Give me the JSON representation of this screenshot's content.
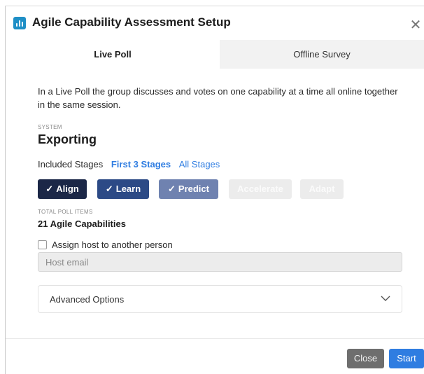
{
  "dialog": {
    "title": "Agile Capability Assessment Setup",
    "app_icon": "bar-chart-icon",
    "close_icon": "close-icon",
    "accent_color": "#1f8fc6"
  },
  "tabs": [
    {
      "label": "Live Poll",
      "active": true
    },
    {
      "label": "Offline Survey",
      "active": false
    }
  ],
  "intro": "In a Live Poll the group discusses and votes on one capability at a time all online together in the same session.",
  "system": {
    "label": "SYSTEM",
    "name": "Exporting"
  },
  "stages": {
    "label": "Included Stages",
    "options": [
      {
        "label": "First 3 Stages",
        "active": true
      },
      {
        "label": "All Stages",
        "active": false
      }
    ],
    "buttons": [
      {
        "label": "Align",
        "selected": true,
        "color": "#1b2747"
      },
      {
        "label": "Learn",
        "selected": true,
        "color": "#2c4a86"
      },
      {
        "label": "Predict",
        "selected": true,
        "color": "#6f82b0"
      },
      {
        "label": "Accelerate",
        "selected": false,
        "color": "#ececec"
      },
      {
        "label": "Adapt",
        "selected": false,
        "color": "#ececec"
      }
    ]
  },
  "total": {
    "label": "TOTAL POLL ITEMS",
    "value": "21 Agile Capabilities"
  },
  "assign_host": {
    "label": "Assign host to another person",
    "checked": false
  },
  "host_email": {
    "placeholder": "Host email",
    "value": ""
  },
  "advanced": {
    "label": "Advanced Options",
    "icon": "chevron-down-icon"
  },
  "footer": {
    "close_label": "Close",
    "start_label": "Start",
    "start_color": "#2f7de1"
  }
}
